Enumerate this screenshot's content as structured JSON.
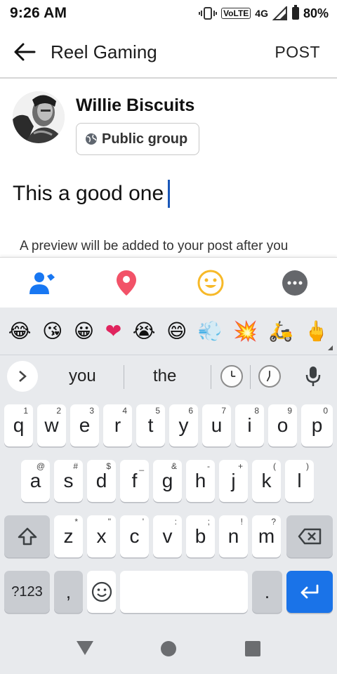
{
  "status": {
    "time": "9:26 AM",
    "volte": "VoLTE",
    "network": "4G",
    "battery": "80%"
  },
  "app_bar": {
    "title": "Reel Gaming",
    "post": "POST"
  },
  "author": {
    "name": "Willie Biscuits",
    "privacy": "Public group"
  },
  "post": {
    "text": "This a good one"
  },
  "preview_note": "A preview will be added to your post after you",
  "actions": [
    "tag-people",
    "location",
    "feeling",
    "more"
  ],
  "keyboard": {
    "emojis": [
      "😂",
      "😘",
      "😀",
      "❤",
      "😭",
      "😄",
      "💨",
      "💥",
      "🛵",
      "🖕"
    ],
    "suggestions": [
      "you",
      "the"
    ],
    "rows": [
      [
        {
          "k": "q",
          "h": "1"
        },
        {
          "k": "w",
          "h": "2"
        },
        {
          "k": "e",
          "h": "3"
        },
        {
          "k": "r",
          "h": "4"
        },
        {
          "k": "t",
          "h": "5"
        },
        {
          "k": "y",
          "h": "6"
        },
        {
          "k": "u",
          "h": "7"
        },
        {
          "k": "i",
          "h": "8"
        },
        {
          "k": "o",
          "h": "9"
        },
        {
          "k": "p",
          "h": "0"
        }
      ],
      [
        {
          "k": "a",
          "h": "@"
        },
        {
          "k": "s",
          "h": "#"
        },
        {
          "k": "d",
          "h": "$"
        },
        {
          "k": "f",
          "h": "_"
        },
        {
          "k": "g",
          "h": "&"
        },
        {
          "k": "h",
          "h": "-"
        },
        {
          "k": "j",
          "h": "+"
        },
        {
          "k": "k",
          "h": "("
        },
        {
          "k": "l",
          "h": ")"
        }
      ],
      [
        {
          "k": "z",
          "h": "*"
        },
        {
          "k": "x",
          "h": "\""
        },
        {
          "k": "c",
          "h": "'"
        },
        {
          "k": "v",
          "h": ":"
        },
        {
          "k": "b",
          "h": ";"
        },
        {
          "k": "n",
          "h": "!"
        },
        {
          "k": "m",
          "h": "?"
        }
      ]
    ],
    "symbols_key": "?123",
    "comma_key": ",",
    "period_key": "."
  },
  "colors": {
    "accent_blue": "#1877f2",
    "location_red": "#f25268",
    "feeling_yellow": "#f7b928",
    "more_gray": "#65676b",
    "keyboard_bg": "#e8eaed",
    "enter_blue": "#1a73e8"
  }
}
